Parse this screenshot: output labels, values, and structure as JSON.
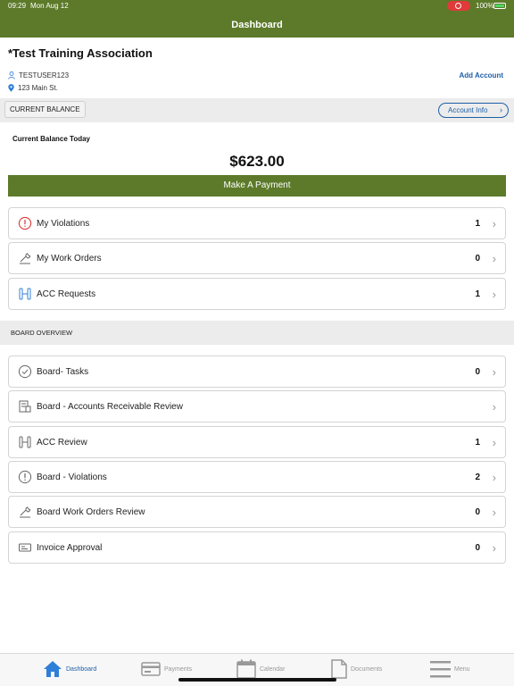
{
  "status_bar": {
    "time": "09:29",
    "date": "Mon Aug 12",
    "battery": "100%"
  },
  "nav": {
    "title": "Dashboard"
  },
  "association": {
    "name": "*Test Training Association",
    "user": "TESTUSER123",
    "address": "123 Main St.",
    "add_account": "Add Account"
  },
  "balance": {
    "chip": "CURRENT BALANCE",
    "account_info": "Account Info",
    "label": "Current Balance Today",
    "amount": "$623.00",
    "pay_button": "Make A Payment"
  },
  "items": [
    {
      "label": "My Violations",
      "count": "1",
      "icon": "alert-circle-icon"
    },
    {
      "label": "My Work Orders",
      "count": "0",
      "icon": "wrench-icon"
    },
    {
      "label": "ACC Requests",
      "count": "1",
      "icon": "acc-icon"
    }
  ],
  "board": {
    "section_title": "BOARD OVERVIEW",
    "items": [
      {
        "label": "Board- Tasks",
        "count": "0",
        "icon": "check-circle-icon"
      },
      {
        "label": "Board - Accounts Receivable Review",
        "count": "",
        "icon": "receipt-icon"
      },
      {
        "label": "ACC Review",
        "count": "1",
        "icon": "acc-icon"
      },
      {
        "label": "Board - Violations",
        "count": "2",
        "icon": "alert-circle-icon"
      },
      {
        "label": "Board Work Orders Review",
        "count": "0",
        "icon": "wrench-icon"
      },
      {
        "label": "Invoice Approval",
        "count": "0",
        "icon": "invoice-icon"
      }
    ]
  },
  "tabs": [
    {
      "label": "Dashboard",
      "icon": "home-icon"
    },
    {
      "label": "Payments",
      "icon": "card-icon"
    },
    {
      "label": "Calendar",
      "icon": "calendar-icon"
    },
    {
      "label": "Documents",
      "icon": "document-icon"
    },
    {
      "label": "Menu",
      "icon": "menu-icon"
    }
  ],
  "colors": {
    "brand_green": "#5c7a29",
    "link_blue": "#1f5fa8",
    "alert_red": "#d93a3a"
  }
}
